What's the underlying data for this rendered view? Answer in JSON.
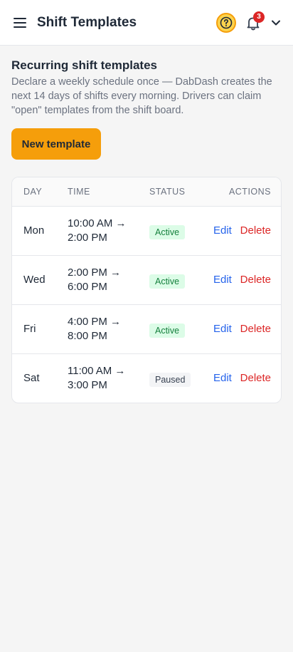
{
  "header": {
    "title": "Shift Templates",
    "notification_count": "3",
    "accent_color": "#f59e0b"
  },
  "main": {
    "heading": "Recurring shift templates",
    "description": "Declare a weekly schedule once — DabDash creates the next 14 days of shifts every morning. Drivers can claim \"open\" templates from the shift board.",
    "new_button_label": "New template"
  },
  "table": {
    "columns": {
      "day": "DAY",
      "time": "TIME",
      "status": "STATUS",
      "actions": "ACTIONS"
    },
    "rows": [
      {
        "day": "Mon",
        "time_line1": "10:00 AM →",
        "time_line2": "2:00 PM",
        "status": "Active",
        "status_type": "active",
        "edit": "Edit",
        "delete": "Delete"
      },
      {
        "day": "Wed",
        "time_line1": "2:00 PM →",
        "time_line2": "6:00 PM",
        "status": "Active",
        "status_type": "active",
        "edit": "Edit",
        "delete": "Delete"
      },
      {
        "day": "Fri",
        "time_line1": "4:00 PM →",
        "time_line2": "8:00 PM",
        "status": "Active",
        "status_type": "active",
        "edit": "Edit",
        "delete": "Delete"
      },
      {
        "day": "Sat",
        "time_line1": "11:00 AM →",
        "time_line2": "3:00 PM",
        "status": "Paused",
        "status_type": "paused",
        "edit": "Edit",
        "delete": "Delete"
      }
    ]
  },
  "icons": {
    "menu": "hamburger-menu-icon",
    "help": "help-circle-icon",
    "notifications": "bell-icon",
    "account": "chevron-down-icon"
  }
}
